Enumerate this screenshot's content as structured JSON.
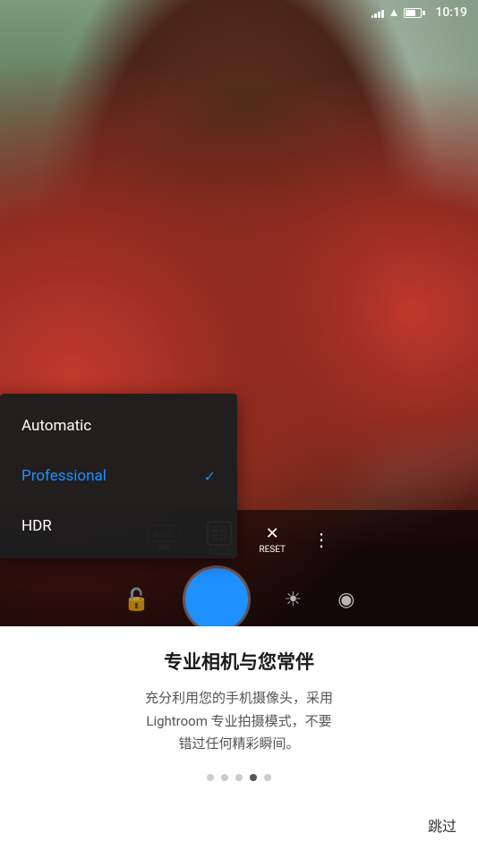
{
  "statusBar": {
    "time": "10:19",
    "signal": "signal",
    "wifi": "wifi",
    "battery": "battery"
  },
  "camera": {
    "controls": [
      {
        "id": "wb",
        "topLabel": "AWB",
        "bottomLabel": "WB"
      },
      {
        "id": "auto",
        "topLabel": "AUTO",
        "bottomLabel": "AUTO"
      },
      {
        "id": "reset",
        "topLabel": "×",
        "bottomLabel": "RESET"
      },
      {
        "id": "more",
        "topLabel": "⋮",
        "bottomLabel": ""
      }
    ]
  },
  "dropdown": {
    "items": [
      {
        "id": "automatic",
        "label": "Automatic",
        "active": false
      },
      {
        "id": "professional",
        "label": "Professional",
        "active": true
      },
      {
        "id": "hdr",
        "label": "HDR",
        "active": false
      }
    ]
  },
  "onboarding": {
    "title": "专业相机与您常伴",
    "description": "充分利用您的手机摄像头，采用\nLightroom 专业拍摄模式，不要\n错过任何精彩瞬间。",
    "dots": [
      {
        "active": false
      },
      {
        "active": false
      },
      {
        "active": false
      },
      {
        "active": true
      },
      {
        "active": false
      }
    ],
    "skipLabel": "跳过"
  }
}
